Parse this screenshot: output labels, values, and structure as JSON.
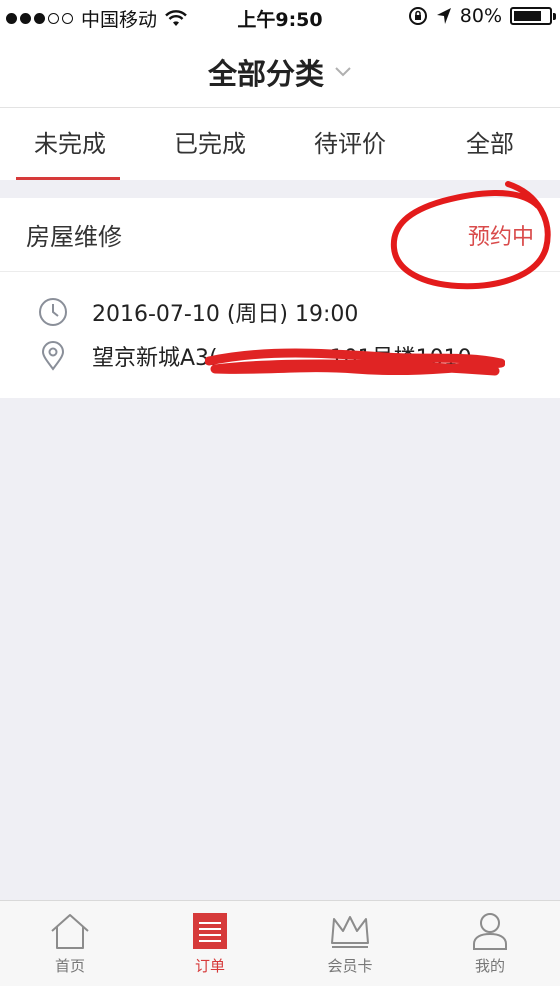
{
  "status_bar": {
    "carrier": "中国移动",
    "time": "上午9:50",
    "battery": "80%",
    "signal_bars": 3
  },
  "header": {
    "title": "全部分类"
  },
  "tabs": [
    {
      "label": "未完成",
      "active": true
    },
    {
      "label": "已完成",
      "active": false
    },
    {
      "label": "待评价",
      "active": false
    },
    {
      "label": "全部",
      "active": false
    }
  ],
  "order": {
    "service": "房屋维修",
    "status": "预约中",
    "datetime": "2016-07-10 (周日) 19:00",
    "address": "望京新城A3(",
    "address_tail": "101号楼1010"
  },
  "bottom_nav": [
    {
      "label": "首页",
      "icon": "home-icon",
      "active": false
    },
    {
      "label": "订单",
      "icon": "orders-icon",
      "active": true
    },
    {
      "label": "会员卡",
      "icon": "crown-icon",
      "active": false
    },
    {
      "label": "我的",
      "icon": "person-icon",
      "active": false
    }
  ],
  "colors": {
    "accent": "#d63a3a",
    "status": "#d94b4b",
    "background": "#efeff4"
  }
}
